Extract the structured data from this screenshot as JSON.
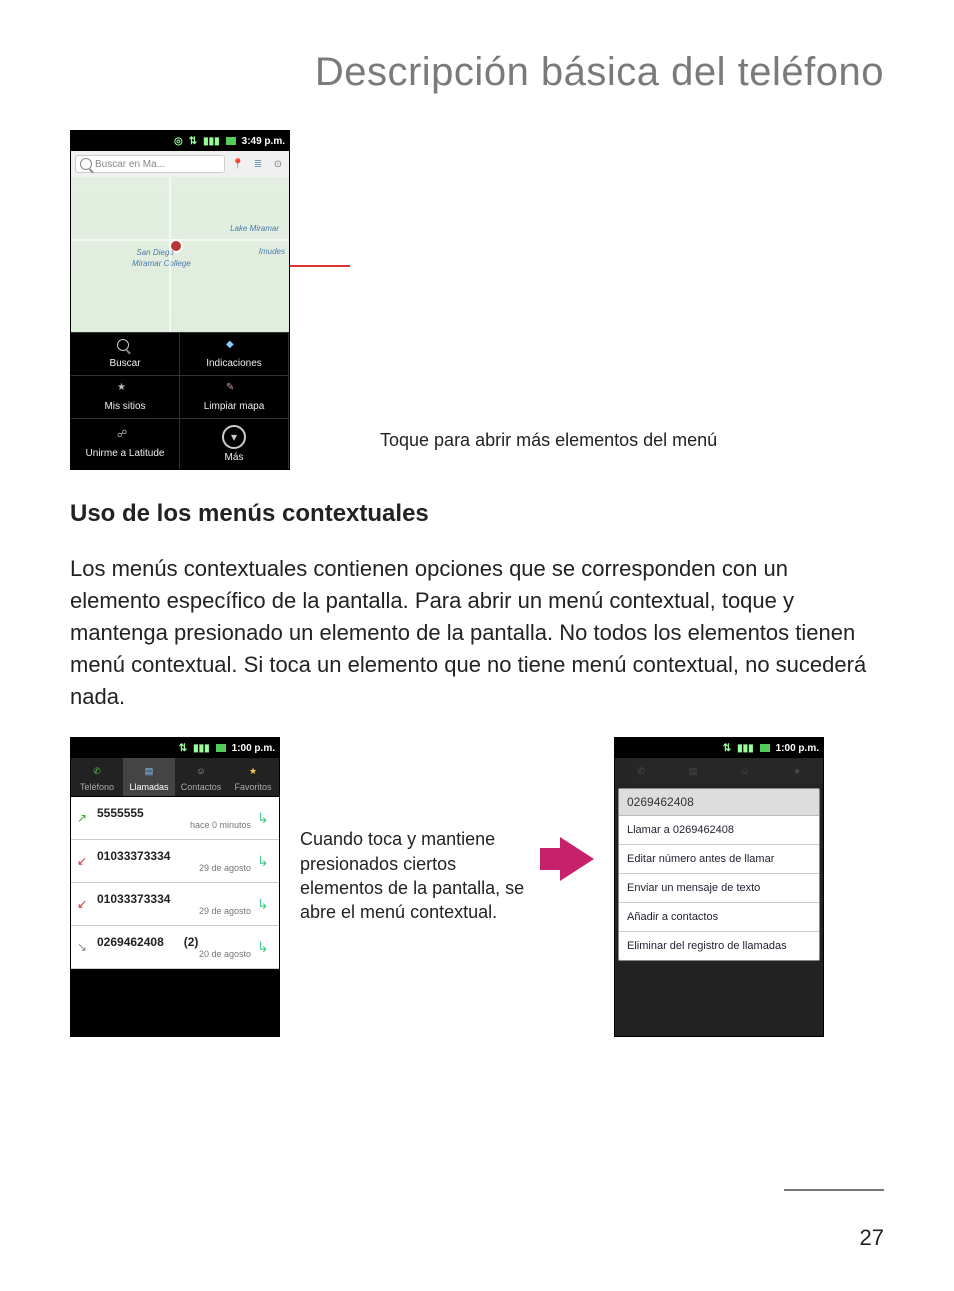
{
  "page": {
    "title": "Descripción básica del teléfono",
    "number": "27"
  },
  "section1": {
    "callout": "Toque para abrir más elementos del menú"
  },
  "map_phone": {
    "status_time": "3:49 p.m.",
    "search_placeholder": "Buscar en Ma...",
    "map_labels": {
      "lake": "Lake Miramar",
      "spot1": "San Diego",
      "spot2": "Miramar College",
      "spot3": "Imudes"
    },
    "menu": {
      "search": "Buscar",
      "directions": "Indicaciones",
      "my_places": "Mis sitios",
      "clear_map": "Limpiar mapa",
      "join_latitude": "Unirme a Latitude",
      "more": "Más"
    }
  },
  "section2": {
    "heading": "Uso de los menús contextuales",
    "body": "Los menús contextuales contienen opciones que se corresponden con un elemento específico de la pantalla. Para abrir un menú contextual, toque y mantenga presionado un elemento de la pantalla. No todos los elementos tienen menú contextual. Si toca un elemento que no tiene menú contextual, no sucederá nada.",
    "caption": "Cuando toca y mantiene presionados ciertos elementos de la pantalla, se abre el menú contextual."
  },
  "call_phone": {
    "status_time": "1:00 p.m.",
    "tabs": {
      "phone": "Teléfono",
      "calls": "Llamadas",
      "contacts": "Contactos",
      "favorites": "Favoritos"
    },
    "rows": [
      {
        "dir": "out",
        "number": "5555555",
        "sub": "hace 0 minutos",
        "count": ""
      },
      {
        "dir": "miss",
        "number": "01033373334",
        "sub": "29 de agosto",
        "count": ""
      },
      {
        "dir": "miss",
        "number": "01033373334",
        "sub": "29 de agosto",
        "count": ""
      },
      {
        "dir": "in",
        "number": "0269462408",
        "sub": "20 de agosto",
        "count": "(2)"
      }
    ]
  },
  "ctx_phone": {
    "status_time": "1:00 p.m.",
    "title": "0269462408",
    "items": {
      "call": "Llamar a 0269462408",
      "edit": "Editar número antes de llamar",
      "sms": "Enviar un mensaje de texto",
      "add": "Añadir a contactos",
      "delete": "Eliminar del registro de llamadas"
    }
  }
}
